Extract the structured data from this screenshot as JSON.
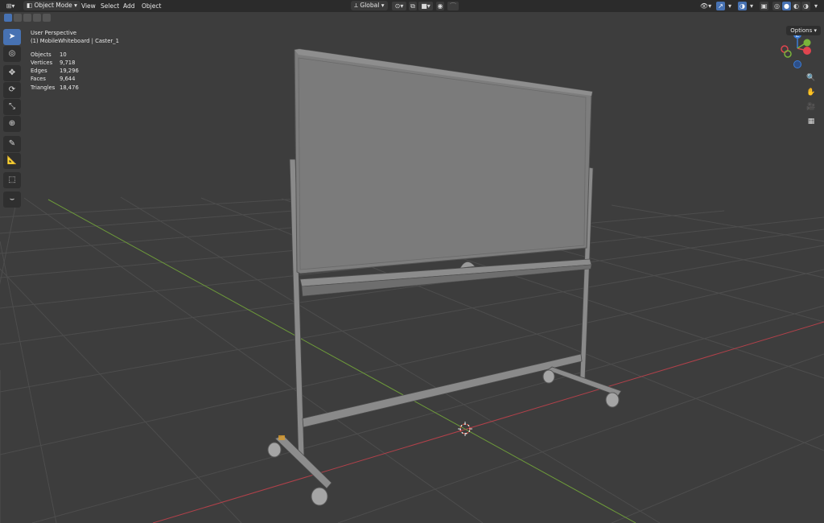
{
  "header": {
    "mode_label": "Object Mode",
    "menus": [
      "View",
      "Select",
      "Add",
      "Object"
    ],
    "transform_orientation": "Global"
  },
  "subheader": {
    "options_label": "Options"
  },
  "overlay": {
    "view_name": "User Perspective",
    "object_context": "(1) MobileWhiteboard | Caster_1",
    "stats": [
      {
        "label": "Objects",
        "value": "10"
      },
      {
        "label": "Vertices",
        "value": "9,718"
      },
      {
        "label": "Edges",
        "value": "19,296"
      },
      {
        "label": "Faces",
        "value": "9,644"
      },
      {
        "label": "Triangles",
        "value": "18,476"
      }
    ]
  },
  "gizmo": {
    "z_label": "Z",
    "x_color": "#e0454f",
    "y_color": "#7ab53a",
    "z_color": "#3b7dd8"
  },
  "tools": [
    {
      "name": "select-box-tool",
      "icon": "cursor-icon",
      "active": true
    },
    {
      "name": "cursor-tool",
      "icon": "3d-cursor-icon",
      "active": false
    },
    {
      "name": "move-tool",
      "icon": "move-icon",
      "active": false
    },
    {
      "name": "rotate-tool",
      "icon": "rotate-icon",
      "active": false
    },
    {
      "name": "scale-tool",
      "icon": "scale-icon",
      "active": false
    },
    {
      "name": "transform-tool",
      "icon": "transform-icon",
      "active": false
    },
    {
      "name": "annotate-tool",
      "icon": "pencil-icon",
      "active": false
    },
    {
      "name": "measure-tool",
      "icon": "ruler-icon",
      "active": false
    },
    {
      "name": "add-cube-tool",
      "icon": "add-cube-icon",
      "active": false
    },
    {
      "name": "sculpt-curve-tool",
      "icon": "curve-icon",
      "active": false
    }
  ]
}
